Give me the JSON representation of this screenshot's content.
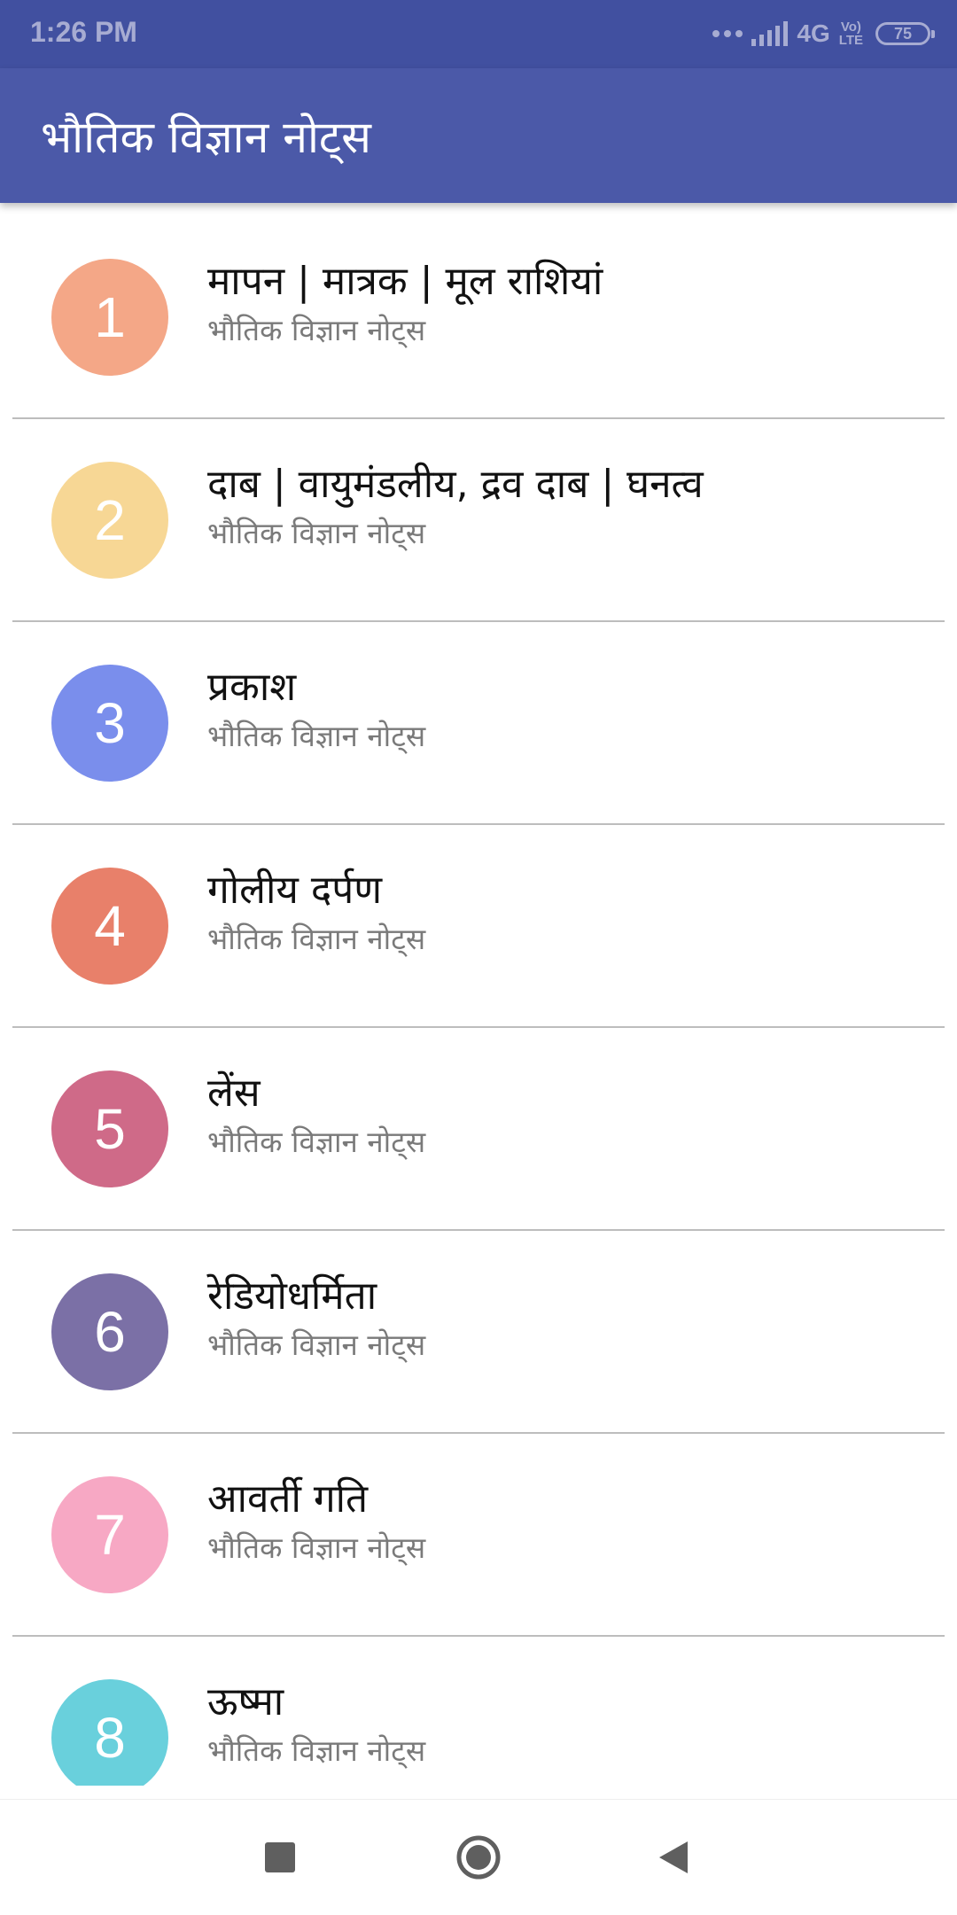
{
  "status_bar": {
    "time": "1:26 PM",
    "network": "4G",
    "volte": "Vo)\nLTE",
    "battery": "75"
  },
  "app_bar": {
    "title": "भौतिक विज्ञान नोट्स"
  },
  "list": {
    "items": [
      {
        "number": "1",
        "title": "मापन | मात्रक | मूल राशियां",
        "subtitle": "भौतिक विज्ञान नोट्स",
        "color": "#f4a787"
      },
      {
        "number": "2",
        "title": "दाब | वायुमंडलीय, द्रव दाब | घनत्व",
        "subtitle": "भौतिक विज्ञान नोट्स",
        "color": "#f7d795"
      },
      {
        "number": "3",
        "title": "प्रकाश",
        "subtitle": "भौतिक विज्ञान नोट्स",
        "color": "#7a8eec"
      },
      {
        "number": "4",
        "title": "गोलीय दर्पण",
        "subtitle": "भौतिक विज्ञान नोट्स",
        "color": "#e8806a"
      },
      {
        "number": "5",
        "title": "लेंस",
        "subtitle": "भौतिक विज्ञान नोट्स",
        "color": "#cf6a88"
      },
      {
        "number": "6",
        "title": "रेडियोधर्मिता",
        "subtitle": "भौतिक विज्ञान नोट्स",
        "color": "#7b70a6"
      },
      {
        "number": "7",
        "title": "आवर्ती गति",
        "subtitle": "भौतिक विज्ञान नोट्स",
        "color": "#f7a8c4"
      },
      {
        "number": "8",
        "title": "ऊष्मा",
        "subtitle": "भौतिक विज्ञान नोट्स",
        "color": "#69d0dc"
      }
    ]
  },
  "nav_bar": {
    "buttons": [
      "recents-icon",
      "home-icon",
      "back-icon"
    ]
  }
}
